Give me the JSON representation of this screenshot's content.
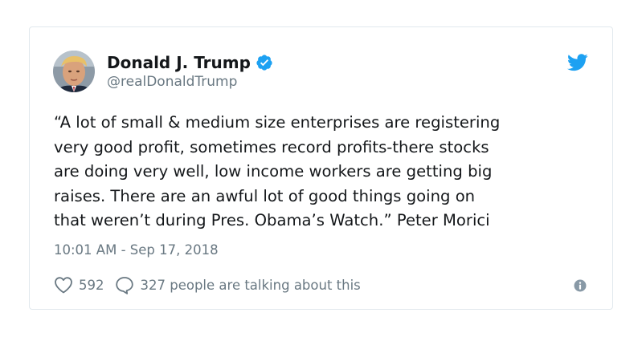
{
  "author": {
    "name": "Donald J. Trump",
    "handle": "@realDonaldTrump",
    "verified": true
  },
  "tweet": {
    "lines": [
      "“A lot of small & medium size enterprises are registering",
      "very good profit, sometimes record profits-there stocks",
      "are doing very well, low income workers are getting big",
      "raises. There are an awful lot of good things going on",
      "that weren’t during Pres. Obama’s Watch.” Peter Morici"
    ],
    "timestamp": "10:01 AM - Sep 17, 2018"
  },
  "actions": {
    "likes": "592",
    "talking": "327 people are talking about this"
  },
  "icons": {
    "verified": "verified-badge-icon",
    "platform": "twitter-bird-icon",
    "like": "heart-icon",
    "reply": "speech-bubble-icon",
    "info": "info-icon"
  },
  "colors": {
    "brand_blue": "#1da1f2",
    "text_primary": "#14171a",
    "text_secondary": "#697882",
    "border": "#e1e8ed"
  }
}
